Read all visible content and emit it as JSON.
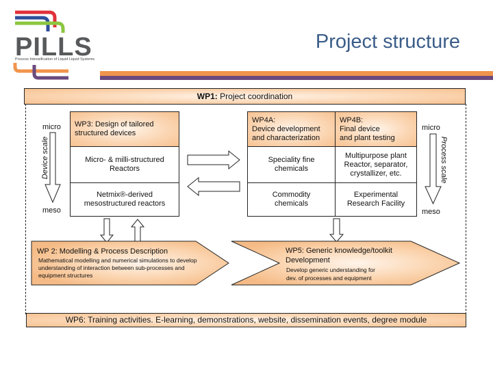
{
  "logo": {
    "name": "PILLS",
    "tagline": "Process Intensification of Liquid Liquid Systems",
    "colors": {
      "red": "#e0303a",
      "blue": "#2f4f9c",
      "green": "#8cc63f",
      "gray": "#58595b",
      "orange": "#f0944c",
      "purple": "#6b4a7e"
    }
  },
  "title": "Project structure",
  "wp1": {
    "label": "WP1:",
    "text": "Project coordination"
  },
  "device_scale": {
    "axis_label": "Device scale",
    "top": "micro",
    "bottom": "meso"
  },
  "process_scale": {
    "axis_label": "Process scale",
    "top": "micro",
    "bottom": "meso"
  },
  "wp3": {
    "header": "WP3: Design of tailored structured devices",
    "rows": [
      "Micro- & milli-structured Reactors",
      "Netmix®-derived mesostructured reactors"
    ]
  },
  "wp4a": {
    "header_lines": [
      "WP4A:",
      "Device development",
      "and characterization"
    ],
    "rows": [
      "Speciality fine chemicals",
      "Commodity chemicals"
    ]
  },
  "wp4b": {
    "header_lines": [
      "WP4B:",
      "Final device",
      "and plant testing"
    ],
    "rows": [
      "Multipurpose plant Reactor, separator, crystallizer, etc.",
      "Experimental Research Facility"
    ]
  },
  "wp2": {
    "title": "WP 2: Modelling & Process Description",
    "description": "Mathematical modelling and numerical simulations to develop understanding of interaction between sub-processes and equipment structures"
  },
  "wp5": {
    "title_lines": [
      "WP5: Generic knowledge/toolkit",
      "Development"
    ],
    "description_lines": [
      "Develop generic understanding for",
      "dev. of processes and equipment"
    ]
  },
  "wp6": {
    "text": "WP6: Training activities. E-learning, demonstrations, website, dissemination events, degree module"
  },
  "colors": {
    "accent_orange": "#f7c291",
    "title_blue": "#3b5d89"
  }
}
